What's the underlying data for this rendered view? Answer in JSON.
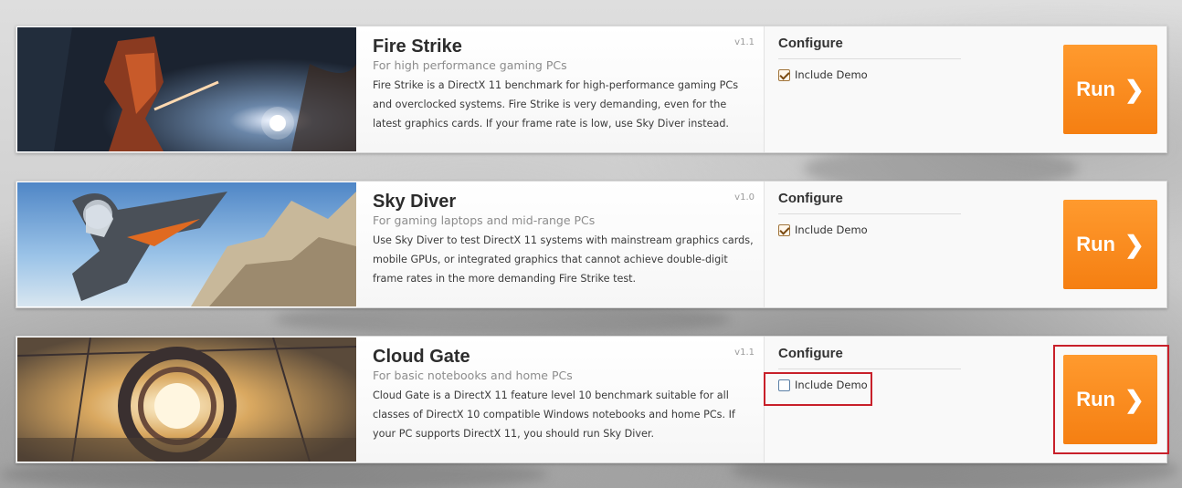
{
  "benchmarks": [
    {
      "title": "Fire Strike",
      "version": "v1.1",
      "subtitle": "For high performance gaming PCs",
      "description": "Fire Strike is a DirectX 11 benchmark for high-performance gaming PCs and overclocked systems. Fire Strike is very demanding, even for the latest graphics cards. If your frame rate is low, use Sky Diver instead.",
      "configure_label": "Configure",
      "include_demo_label": "Include Demo",
      "include_demo_checked": true,
      "run_label": "Run",
      "run_icon": "chevron-right-icon"
    },
    {
      "title": "Sky Diver",
      "version": "v1.0",
      "subtitle": "For gaming laptops and mid-range PCs",
      "description": "Use Sky Diver to test DirectX 11 systems with mainstream graphics cards, mobile GPUs, or integrated graphics that cannot achieve double-digit frame rates in the more demanding Fire Strike test.",
      "configure_label": "Configure",
      "include_demo_label": "Include Demo",
      "include_demo_checked": true,
      "run_label": "Run",
      "run_icon": "chevron-right-icon"
    },
    {
      "title": "Cloud Gate",
      "version": "v1.1",
      "subtitle": "For basic notebooks and home PCs",
      "description": "Cloud Gate is a DirectX 11 feature level 10 benchmark suitable for all classes of DirectX 10 compatible Windows notebooks and home PCs. If your PC supports DirectX 11, you should run Sky Diver.",
      "configure_label": "Configure",
      "include_demo_label": "Include Demo",
      "include_demo_checked": false,
      "run_label": "Run",
      "run_icon": "chevron-right-icon"
    }
  ],
  "colors": {
    "run_button": "#f7861a",
    "highlight": "#c8202a"
  }
}
